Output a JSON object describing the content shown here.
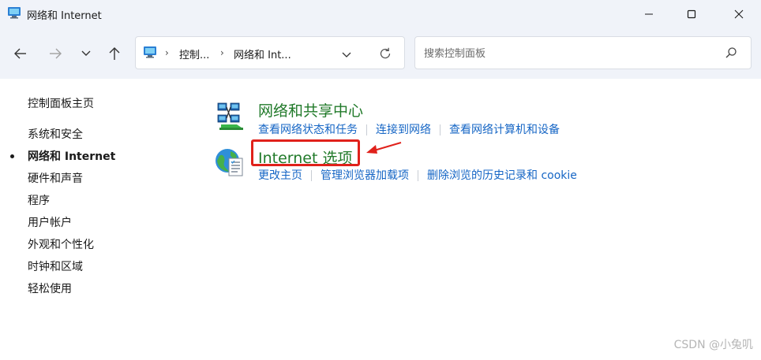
{
  "window": {
    "title": "网络和 Internet",
    "minimize_icon": "minimize-icon",
    "maximize_icon": "maximize-icon",
    "close_icon": "close-icon"
  },
  "navigation": {
    "back_icon": "arrow-left-icon",
    "forward_icon": "arrow-right-icon",
    "recent_icon": "chevron-down-icon",
    "up_icon": "arrow-up-icon",
    "address": {
      "crumbs": [
        "控制...",
        "网络和 Int..."
      ],
      "dropdown_icon": "chevron-down-icon",
      "refresh_icon": "refresh-icon"
    },
    "search": {
      "placeholder": "搜索控制面板",
      "value": "",
      "icon": "search-icon"
    }
  },
  "sidebar": {
    "home": "控制面板主页",
    "items": [
      {
        "label": "系统和安全",
        "active": false
      },
      {
        "label": "网络和 Internet",
        "active": true
      },
      {
        "label": "硬件和声音",
        "active": false
      },
      {
        "label": "程序",
        "active": false
      },
      {
        "label": "用户帐户",
        "active": false
      },
      {
        "label": "外观和个性化",
        "active": false
      },
      {
        "label": "时钟和区域",
        "active": false
      },
      {
        "label": "轻松使用",
        "active": false
      }
    ]
  },
  "categories": [
    {
      "title": "网络和共享中心",
      "icon": "network-sharing-icon",
      "links": [
        "查看网络状态和任务",
        "连接到网络",
        "查看网络计算机和设备"
      ]
    },
    {
      "title": "Internet 选项",
      "icon": "internet-options-icon",
      "links": [
        "更改主页",
        "管理浏览器加载项",
        "删除浏览的历史记录和 cookie"
      ]
    }
  ],
  "annotation": {
    "highlight_color": "#e0211b",
    "target": "Internet 选项"
  },
  "watermark": "CSDN @小兔叽",
  "colors": {
    "chrome_bg": "#f0f3f9",
    "category_title": "#217a2a",
    "link": "#1666c5"
  }
}
